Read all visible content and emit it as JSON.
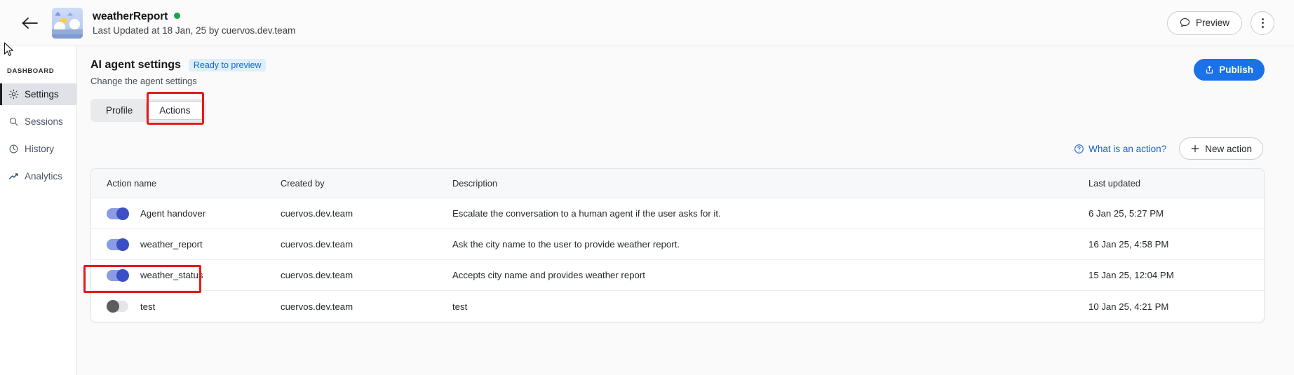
{
  "topbar": {
    "back_icon": "arrow-left-icon",
    "avatar_alt": "weather-illustration-avatar",
    "agent_name": "weatherReport",
    "status": "online",
    "subtitle": "Last Updated at 18 Jan, 25 by cuervos.dev.team",
    "preview_label": "Preview",
    "preview_icon": "chat-bubble-icon",
    "kebab_icon": "more-vertical-icon"
  },
  "sidebar": {
    "section_label": "DASHBOARD",
    "items": [
      {
        "label": "Settings",
        "icon": "gear-icon",
        "active": true
      },
      {
        "label": "Sessions",
        "icon": "chat-search-icon",
        "active": false
      },
      {
        "label": "History",
        "icon": "clock-history-icon",
        "active": false
      },
      {
        "label": "Analytics",
        "icon": "trend-up-icon",
        "active": false
      }
    ]
  },
  "main": {
    "title": "AI agent settings",
    "badge": "Ready to preview",
    "subtitle": "Change the agent settings",
    "publish_label": "Publish",
    "publish_icon": "upload-share-icon",
    "tabs": [
      {
        "label": "Profile",
        "active": false
      },
      {
        "label": "Actions",
        "active": true
      }
    ],
    "what_is_action_label": "What is an action?",
    "what_is_action_icon": "question-circle-icon",
    "new_action_label": "New action",
    "new_action_icon": "plus-icon"
  },
  "table": {
    "columns": [
      "Action name",
      "Created by",
      "Description",
      "Last updated"
    ],
    "rows": [
      {
        "enabled": "on",
        "name": "Agent handover",
        "created_by": "cuervos.dev.team",
        "description": "Escalate the conversation to a human agent if the user asks for it.",
        "last_updated": "6 Jan 25, 5:27 PM"
      },
      {
        "enabled": "on",
        "name": "weather_report",
        "created_by": "cuervos.dev.team",
        "description": "Ask the city name to the user to provide weather report.",
        "last_updated": "16 Jan 25, 4:58 PM"
      },
      {
        "enabled": "on",
        "name": "weather_status",
        "created_by": "cuervos.dev.team",
        "description": "Accepts city name and provides weather report",
        "last_updated": "15 Jan 25, 12:04 PM"
      },
      {
        "enabled": "off",
        "name": "test",
        "created_by": "cuervos.dev.team",
        "description": "test",
        "last_updated": "10 Jan 25, 4:21 PM"
      }
    ]
  },
  "colors": {
    "accent_blue": "#1b72e8",
    "link_blue": "#1b61c9",
    "badge_bg": "#ddeefd",
    "toggle_on_track": "#8a9ce3",
    "toggle_on_knob": "#3b4ec4",
    "toggle_off_knob": "#5c5c5e",
    "status_green": "#19a64a",
    "highlight_red": "#e8191b"
  }
}
